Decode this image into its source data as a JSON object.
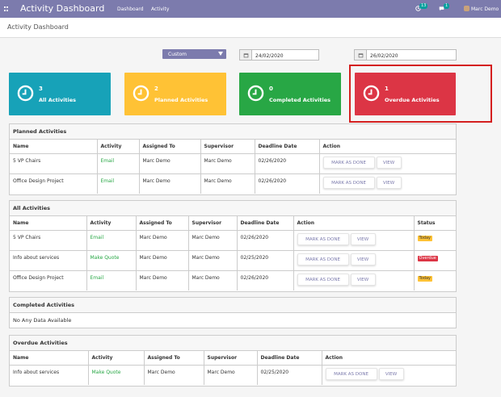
{
  "topbar": {
    "title": "Activity Dashboard",
    "menu": [
      "Dashboard",
      "Activity"
    ],
    "activity_badge": "13",
    "message_badge": "1",
    "user": "Marc Demo"
  },
  "breadcrumb": "Activity Dashboard",
  "filters": {
    "range": "Custom",
    "start_date": "24/02/2020",
    "end_date": "26/02/2020"
  },
  "cards": [
    {
      "count": "3",
      "label": "All Activities",
      "color": "#17a2b8"
    },
    {
      "count": "2",
      "label": "Planned Activities",
      "color": "#ffc235"
    },
    {
      "count": "0",
      "label": "Completed Activities",
      "color": "#28a745"
    },
    {
      "count": "1",
      "label": "Overdue Activities",
      "color": "#dc3545"
    }
  ],
  "buttons": {
    "mark_done": "MARK AS DONE",
    "view": "VIEW"
  },
  "planned": {
    "title": "Planned Activities",
    "headers": [
      "Name",
      "Activity",
      "Assigned To",
      "Supervisor",
      "Deadline Date",
      "Action"
    ],
    "rows": [
      {
        "name": "5 VP Chairs",
        "activity": "Email",
        "assigned": "Marc Demo",
        "supervisor": "Marc Demo",
        "deadline": "02/26/2020"
      },
      {
        "name": "Office Design Project",
        "activity": "Email",
        "assigned": "Marc Demo",
        "supervisor": "Marc Demo",
        "deadline": "02/26/2020"
      }
    ]
  },
  "all": {
    "title": "All Activities",
    "headers": [
      "Name",
      "Activity",
      "Assigned To",
      "Supervisor",
      "Deadline Date",
      "Action",
      "Status"
    ],
    "rows": [
      {
        "name": "5 VP Chairs",
        "activity": "Email",
        "assigned": "Marc Demo",
        "supervisor": "Marc Demo",
        "deadline": "02/26/2020",
        "status": "Today"
      },
      {
        "name": "Info about services",
        "activity": "Make Quote",
        "assigned": "Marc Demo",
        "supervisor": "Marc Demo",
        "deadline": "02/25/2020",
        "status": "Overdue"
      },
      {
        "name": "Office Design Project",
        "activity": "Email",
        "assigned": "Marc Demo",
        "supervisor": "Marc Demo",
        "deadline": "02/26/2020",
        "status": "Today"
      }
    ]
  },
  "completed": {
    "title": "Completed Activities",
    "empty": "No Any Data Available"
  },
  "overdue": {
    "title": "Overdue Activities",
    "headers": [
      "Name",
      "Activity",
      "Assigned To",
      "Supervisor",
      "Deadline Date",
      "Action"
    ],
    "rows": [
      {
        "name": "Info about services",
        "activity": "Make Quote",
        "assigned": "Marc Demo",
        "supervisor": "Marc Demo",
        "deadline": "02/25/2020"
      }
    ]
  },
  "colors": {
    "brand": "#7c7bad",
    "highlight": "#d41f1f",
    "activity_green": "#28a745"
  }
}
